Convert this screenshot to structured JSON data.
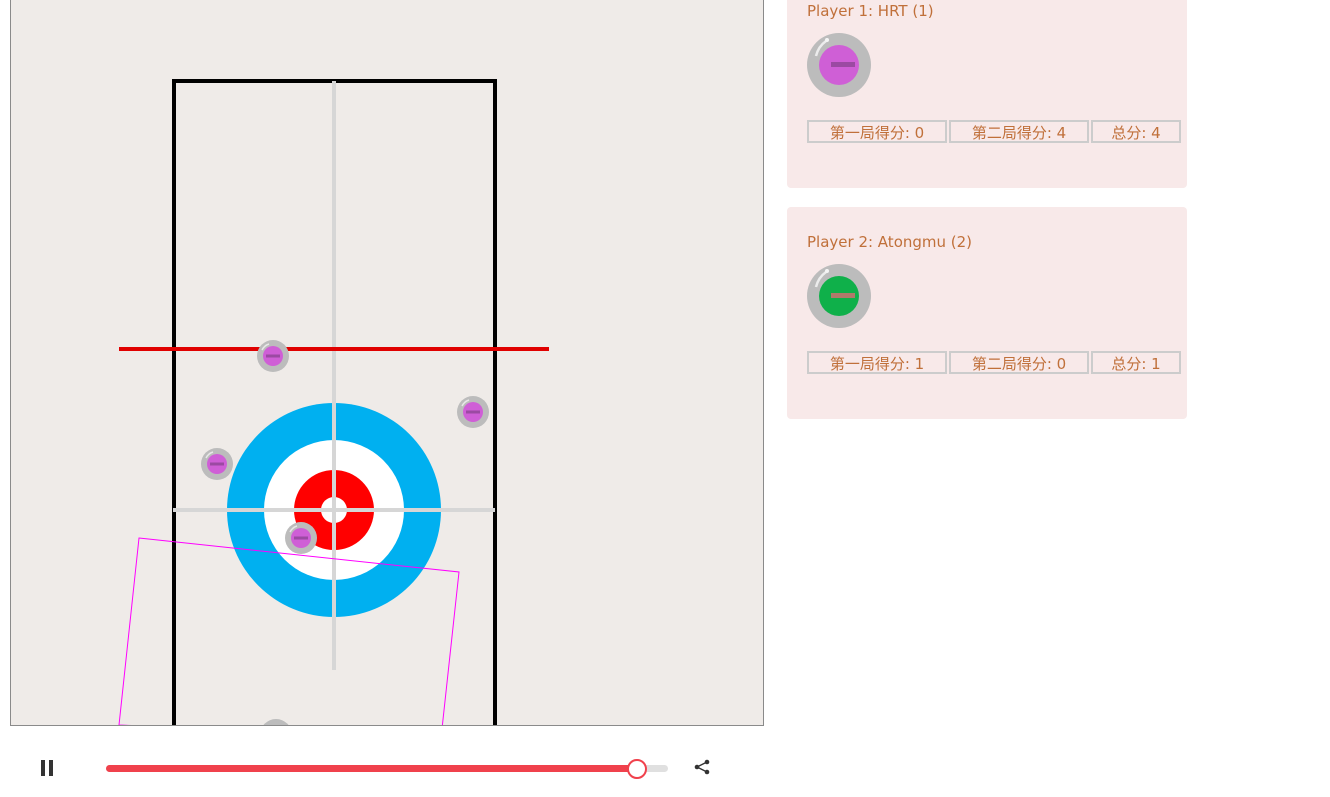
{
  "players": [
    {
      "label": "Player 1: HRT (1)",
      "stone_icon": "purple-curling-stone",
      "stone_color": "#cf5fd6",
      "scores": {
        "game1": "第一局得分: 0",
        "game2": "第二局得分: 4",
        "total": "总分: 4"
      }
    },
    {
      "label": "Player 2: Atongmu (2)",
      "stone_icon": "green-curling-stone",
      "stone_color": "#0fb04a",
      "scores": {
        "game1": "第一局得分: 1",
        "game2": "第二局得分: 0",
        "total": "总分: 1"
      }
    }
  ],
  "sheet": {
    "house_colors": {
      "outer": "#00b0f0",
      "middle": "#ffffff",
      "inner": "#ff0000",
      "button": "#ffffff"
    },
    "hog_line_color": "#e00000",
    "sideline_color": "#000000",
    "centerline_color": "#d6d6d6",
    "guide_frame_color": "#ff00ff",
    "ice_color": "#efebe8",
    "stone_count_on_sheet": 5
  },
  "player_controls": {
    "pause_icon": "pause-icon",
    "share_icon": "share-icon",
    "progress_percent": 94.3,
    "accent_color": "#f0414c"
  }
}
